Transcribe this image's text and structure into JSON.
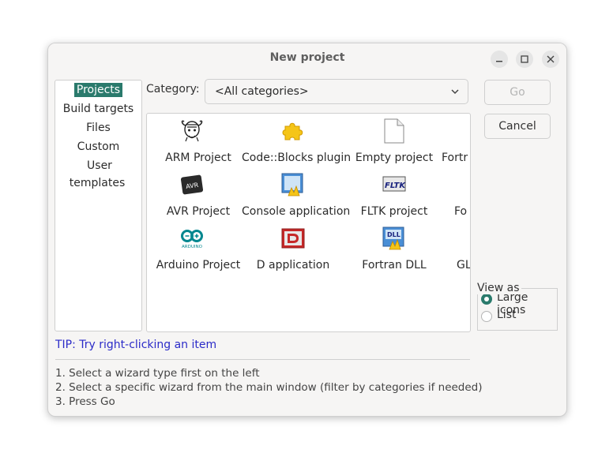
{
  "window": {
    "title": "New project"
  },
  "wizard_types": [
    {
      "label": "Projects",
      "selected": true
    },
    {
      "label": "Build targets",
      "selected": false
    },
    {
      "label": "Files",
      "selected": false
    },
    {
      "label": "Custom",
      "selected": false
    },
    {
      "label": "User templates",
      "selected": false
    }
  ],
  "category": {
    "label": "Category:",
    "value": "<All categories>"
  },
  "buttons": {
    "go": "Go",
    "cancel": "Cancel"
  },
  "templates": [
    {
      "label": "ARM Project",
      "icon": "gnu-icon"
    },
    {
      "label": "Code::Blocks plugin",
      "icon": "puzzle-icon"
    },
    {
      "label": "Empty project",
      "icon": "blank-page-icon"
    },
    {
      "label": "Fortr",
      "icon": ""
    },
    {
      "label": "AVR Project",
      "icon": "avr-chip-icon"
    },
    {
      "label": "Console application",
      "icon": "console-app-icon"
    },
    {
      "label": "FLTK project",
      "icon": "fltk-icon"
    },
    {
      "label": "Fo",
      "icon": ""
    },
    {
      "label": "Arduino Project",
      "icon": "arduino-icon"
    },
    {
      "label": "D application",
      "icon": "d-app-icon"
    },
    {
      "label": "Fortran DLL",
      "icon": "dll-icon"
    },
    {
      "label": "GL",
      "icon": ""
    }
  ],
  "view_as": {
    "title": "View as",
    "options": [
      {
        "label": "Large icons",
        "selected": true
      },
      {
        "label": "List",
        "selected": false
      }
    ]
  },
  "tip": "TIP: Try right-clicking an item",
  "instructions": [
    "1. Select a wizard type first on the left",
    "2. Select a specific wizard from the main window (filter by categories if needed)",
    "3. Press Go"
  ],
  "colors": {
    "accent": "#2a7a6c",
    "tip": "#2b2bc8"
  }
}
